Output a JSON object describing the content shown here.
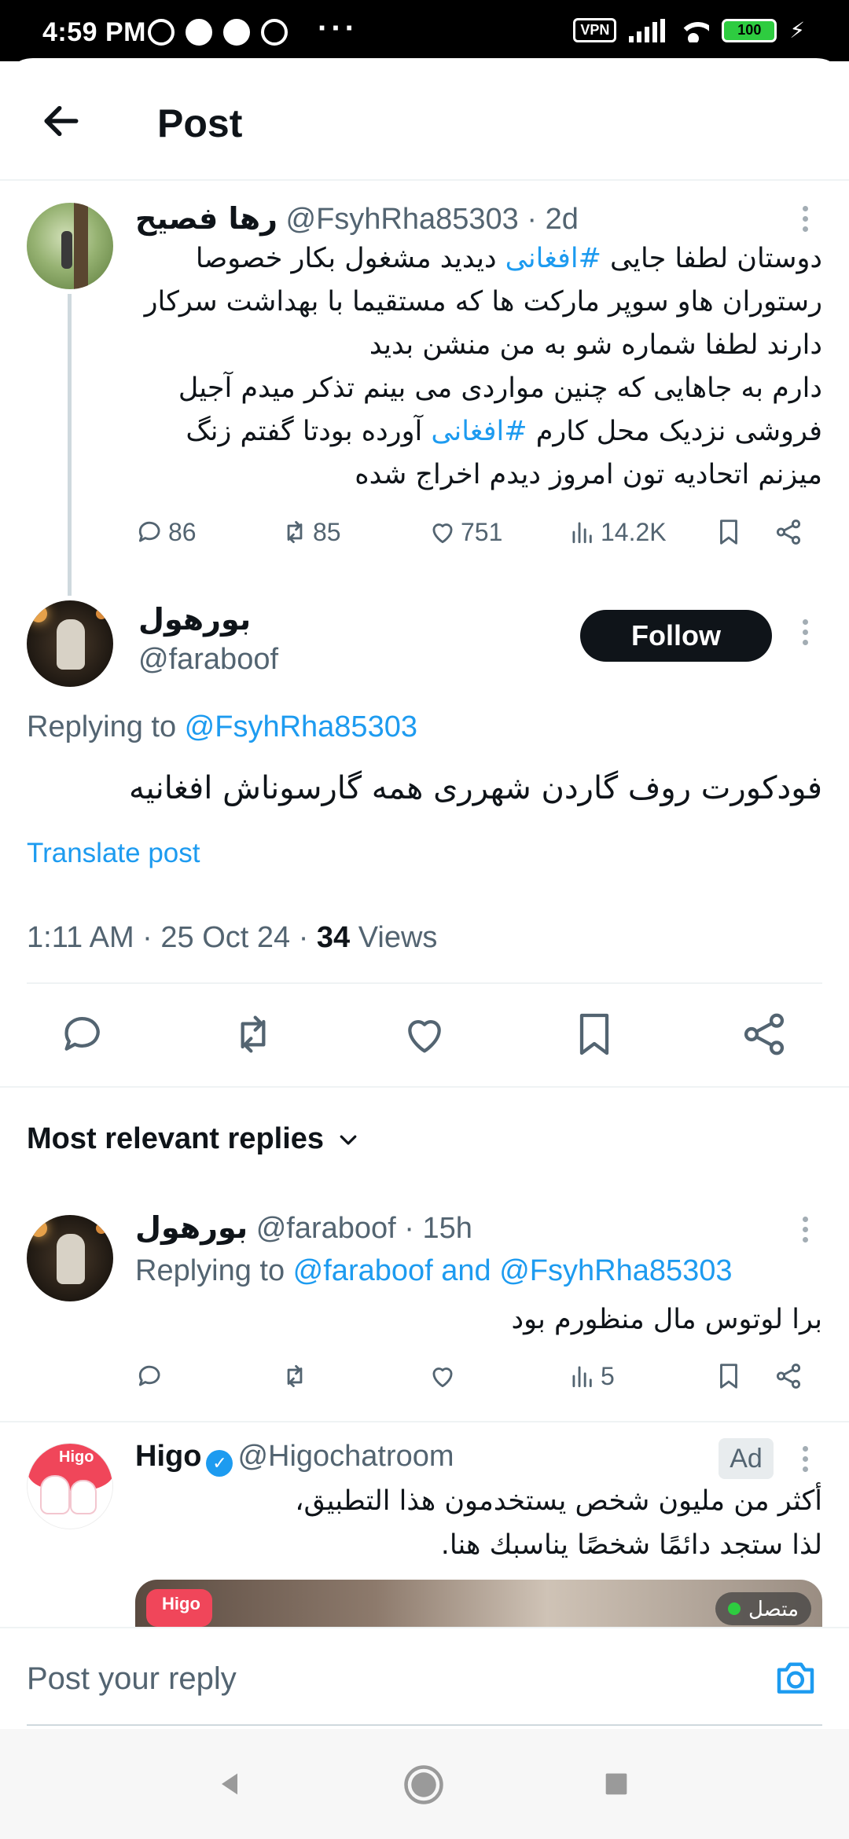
{
  "status_bar": {
    "time": "4:59 PM",
    "vpn": "VPN",
    "battery": "100",
    "more": "···"
  },
  "header": {
    "title": "Post"
  },
  "parent_tweet": {
    "name": "رها فصیح",
    "handle_time": "@FsyhRha85303 · 2d",
    "lines": [
      [
        "دوستان لطفا جایی ",
        "#افغانی",
        " دیدید مشغول بکار خصوصا"
      ],
      [
        "رستوران هاو سوپر مارکت ها که مستقیما با بهداشت سرکار"
      ],
      [
        "دارند لطفا شماره شو به من منشن بدید"
      ],
      [
        "دارم به جاهایی که چنین مواردی می بینم تذکر میدم آجیل"
      ],
      [
        "فروشی نزدیک محل کارم ",
        "#افغانی",
        " آورده بودتا گفتم زنگ"
      ],
      [
        "میزنم اتحادیه تون امروز دیدم اخراج شده"
      ]
    ],
    "stats": {
      "replies": "86",
      "retweets": "85",
      "likes": "751",
      "views": "14.2K"
    }
  },
  "main_tweet": {
    "name": "بورهول",
    "handle": "@faraboof",
    "follow_label": "Follow",
    "replying_prefix": "Replying to ",
    "replying_to": "@FsyhRha85303",
    "text": "فودکورت روف گاردن شهرری همه گارسوناش افغانیه",
    "translate": "Translate post",
    "time": "1:11 AM · 25 Oct 24 · ",
    "views_count": "34",
    "views_label": " Views"
  },
  "sort": {
    "label": "Most relevant replies"
  },
  "reply_tweet": {
    "name": "بورهول",
    "handle_time": "@faraboof · 15h",
    "replying_prefix": "Replying to ",
    "replying_to": "@faraboof and @FsyhRha85303",
    "text": "برا لوتوس مال منظورم بود",
    "stats": {
      "views": "5"
    }
  },
  "ad_tweet": {
    "name": "Higo",
    "handle": "@Higochatroom",
    "ad_label": "Ad",
    "line1": "أكثر من مليون شخص يستخدمون هذا التطبيق،",
    "line2": "لذا ستجد دائمًا شخصًا يناسبك هنا.",
    "image_logo": "Higo",
    "image_status": "متصل"
  },
  "reply_bar": {
    "placeholder": "Post your reply"
  },
  "avatar_labels": {
    "higo": "Higo"
  },
  "colors": {
    "link": "#1d9bf0",
    "muted": "#536471",
    "text": "#0f1419"
  }
}
